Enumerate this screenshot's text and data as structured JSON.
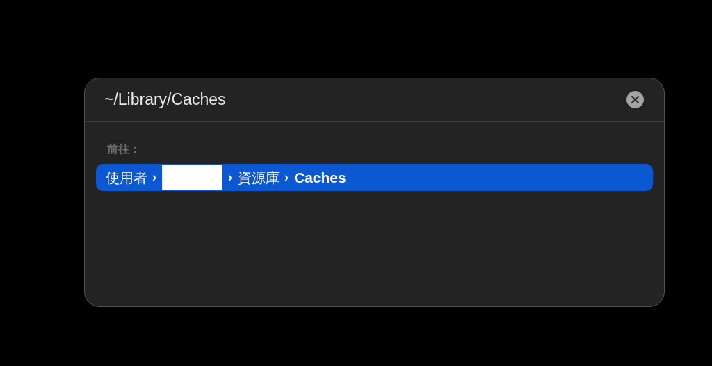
{
  "window": {
    "path": "~/Library/Caches"
  },
  "section_label": "前往：",
  "results": [
    {
      "selected": true,
      "crumbs": [
        {
          "kind": "text",
          "text": "使用者"
        },
        {
          "kind": "separator",
          "text": "›"
        },
        {
          "kind": "redacted"
        },
        {
          "kind": "separator",
          "text": "›"
        },
        {
          "kind": "text",
          "text": "資源庫"
        },
        {
          "kind": "separator",
          "text": "›"
        },
        {
          "kind": "current",
          "text": "Caches"
        }
      ]
    }
  ]
}
